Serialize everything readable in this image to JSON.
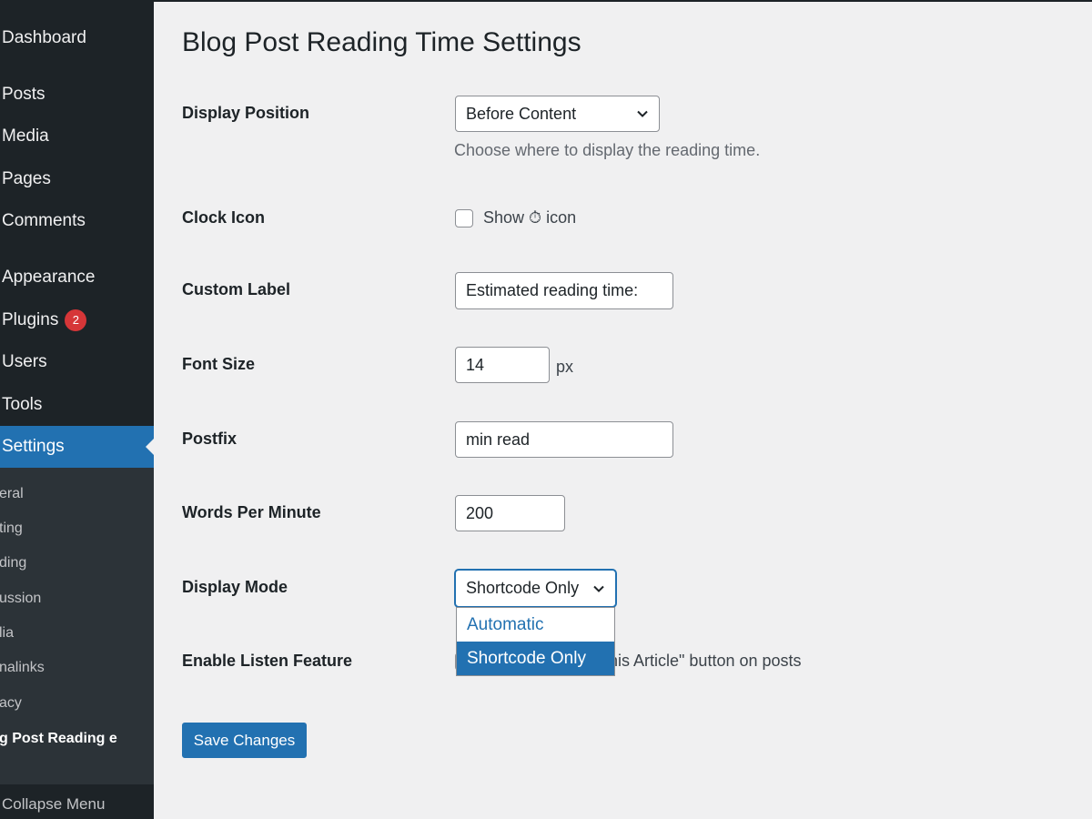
{
  "sidebar": {
    "items": [
      {
        "label": "Dashboard"
      },
      {
        "label": "Posts"
      },
      {
        "label": "Media"
      },
      {
        "label": "Pages"
      },
      {
        "label": "Comments"
      },
      {
        "label": "Appearance"
      },
      {
        "label": "Plugins",
        "badge": "2"
      },
      {
        "label": "Users"
      },
      {
        "label": "Tools"
      },
      {
        "label": "Settings"
      }
    ],
    "submenu": [
      "eral",
      "ting",
      "ding",
      "ussion",
      "lia",
      "nalinks",
      "acy",
      "g Post Reading e"
    ],
    "collapse_label": "Collapse Menu"
  },
  "page": {
    "title": "Blog Post Reading Time Settings"
  },
  "fields": {
    "display_position": {
      "label": "Display Position",
      "value": "Before Content",
      "description": "Choose where to display the reading time."
    },
    "clock_icon": {
      "label": "Clock Icon",
      "checkbox_text_before": "Show",
      "checkbox_text_after": "icon",
      "checked": false
    },
    "custom_label": {
      "label": "Custom Label",
      "value": "Estimated reading time:"
    },
    "font_size": {
      "label": "Font Size",
      "value": "14",
      "unit": "px"
    },
    "postfix": {
      "label": "Postfix",
      "value": "min read"
    },
    "words_per_minute": {
      "label": "Words Per Minute",
      "value": "200"
    },
    "display_mode": {
      "label": "Display Mode",
      "value": "Shortcode Only",
      "options": [
        "Automatic",
        "Shortcode Only"
      ],
      "selected_option": "Shortcode Only"
    },
    "listen_feature": {
      "label": "Enable Listen Feature",
      "text": "his Article\" button on posts"
    }
  },
  "save_button": {
    "label": "Save Changes"
  },
  "colors": {
    "sidebar_bg": "#1d2327",
    "submenu_bg": "#2c3338",
    "accent": "#2271b1",
    "badge": "#d63638",
    "page_bg": "#f0f0f1"
  }
}
